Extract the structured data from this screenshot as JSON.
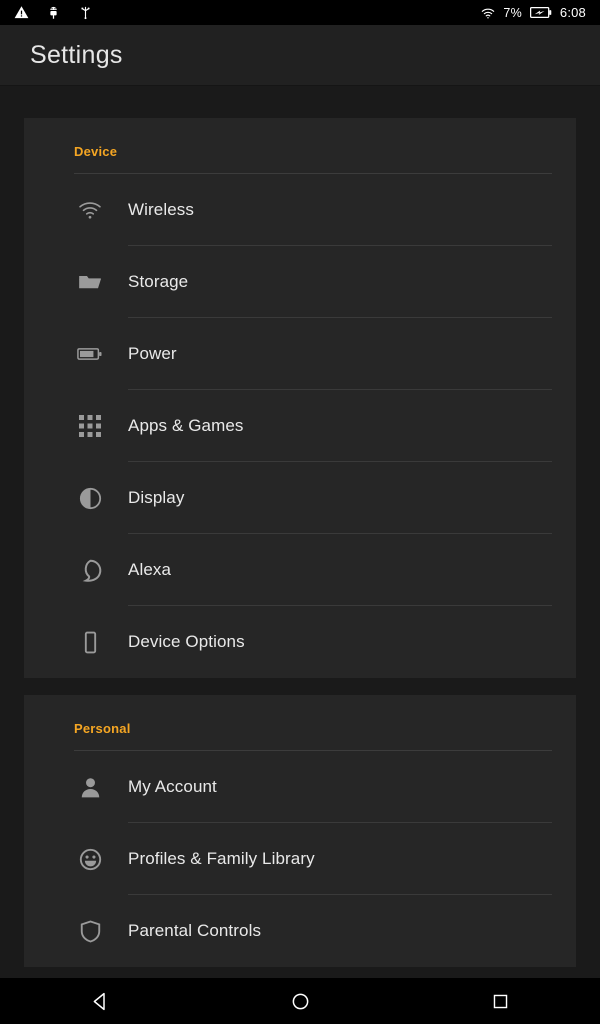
{
  "status_bar": {
    "left_icons": [
      {
        "name": "warning-icon",
        "label": "warning"
      },
      {
        "name": "android-debug-icon",
        "label": "android debug"
      },
      {
        "name": "usb-icon",
        "label": "usb"
      }
    ],
    "wifi_icon": "wifi-icon",
    "battery_percent": "7%",
    "battery_icon": "battery-charging-icon",
    "time": "6:08"
  },
  "app_bar": {
    "title": "Settings"
  },
  "theme": {
    "page_background": "#1a1a1a",
    "card_background": "#262626",
    "accent": "#f5a623",
    "label_color": "#e9e9e9",
    "icon_color": "#9a9a9a",
    "divider": "#3a3a3a"
  },
  "sections": [
    {
      "header": "Device",
      "items": [
        {
          "label": "Wireless",
          "icon": "wifi-icon"
        },
        {
          "label": "Storage",
          "icon": "folder-icon"
        },
        {
          "label": "Power",
          "icon": "battery-icon"
        },
        {
          "label": "Apps & Games",
          "icon": "apps-grid-icon"
        },
        {
          "label": "Display",
          "icon": "contrast-icon"
        },
        {
          "label": "Alexa",
          "icon": "alexa-ring-icon"
        },
        {
          "label": "Device Options",
          "icon": "tablet-icon"
        }
      ]
    },
    {
      "header": "Personal",
      "items": [
        {
          "label": "My Account",
          "icon": "person-icon"
        },
        {
          "label": "Profiles & Family Library",
          "icon": "smiley-icon"
        },
        {
          "label": "Parental Controls",
          "icon": "shield-icon"
        }
      ]
    }
  ],
  "nav_bar": {
    "back": "back-button",
    "home": "home-button",
    "recents": "recents-button"
  }
}
